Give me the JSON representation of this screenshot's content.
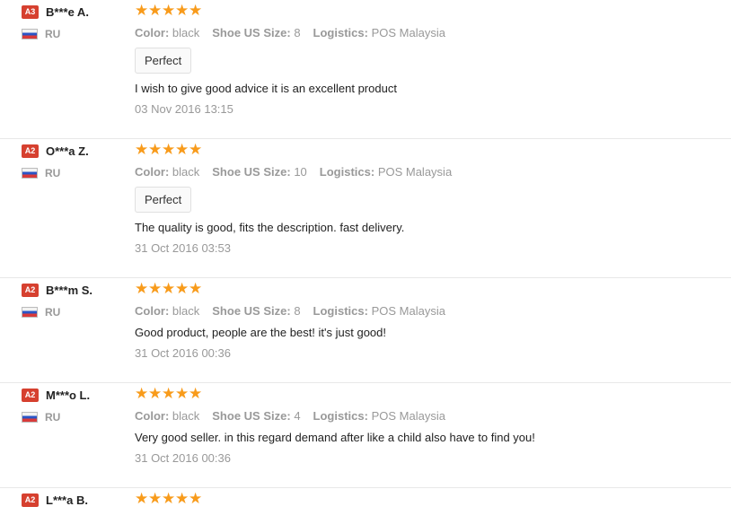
{
  "reviews": [
    {
      "level": "A3",
      "name": "B***e A.",
      "country": "RU",
      "rating": 5,
      "color_label": "Color:",
      "color": "black",
      "size_label": "Shoe US Size:",
      "size": "8",
      "logistics_label": "Logistics:",
      "logistics": "POS Malaysia",
      "tag": "Perfect",
      "text": "I wish to give good advice it is an excellent product",
      "date": "03 Nov 2016 13:15"
    },
    {
      "level": "A2",
      "name": "O***a Z.",
      "country": "RU",
      "rating": 5,
      "color_label": "Color:",
      "color": "black",
      "size_label": "Shoe US Size:",
      "size": "10",
      "logistics_label": "Logistics:",
      "logistics": "POS Malaysia",
      "tag": "Perfect",
      "text": "The quality is good, fits the description. fast delivery.",
      "date": "31 Oct 2016 03:53"
    },
    {
      "level": "A2",
      "name": "B***m S.",
      "country": "RU",
      "rating": 5,
      "color_label": "Color:",
      "color": "black",
      "size_label": "Shoe US Size:",
      "size": "8",
      "logistics_label": "Logistics:",
      "logistics": "POS Malaysia",
      "text": "Good product, people are the best! it's just good!",
      "date": "31 Oct 2016 00:36"
    },
    {
      "level": "A2",
      "name": "M***o L.",
      "country": "RU",
      "rating": 5,
      "color_label": "Color:",
      "color": "black",
      "size_label": "Shoe US Size:",
      "size": "4",
      "logistics_label": "Logistics:",
      "logistics": "POS Malaysia",
      "text": "Very good seller. in this regard demand after like a child also have to find you!",
      "date": "31 Oct 2016 00:36"
    },
    {
      "level": "A2",
      "name": "L***a B.",
      "rating": 5
    }
  ],
  "icons": {
    "star": "star-icon",
    "flag": "russia-flag-icon"
  },
  "colors": {
    "star": "#f89b1b",
    "badge": "#d6402f"
  }
}
